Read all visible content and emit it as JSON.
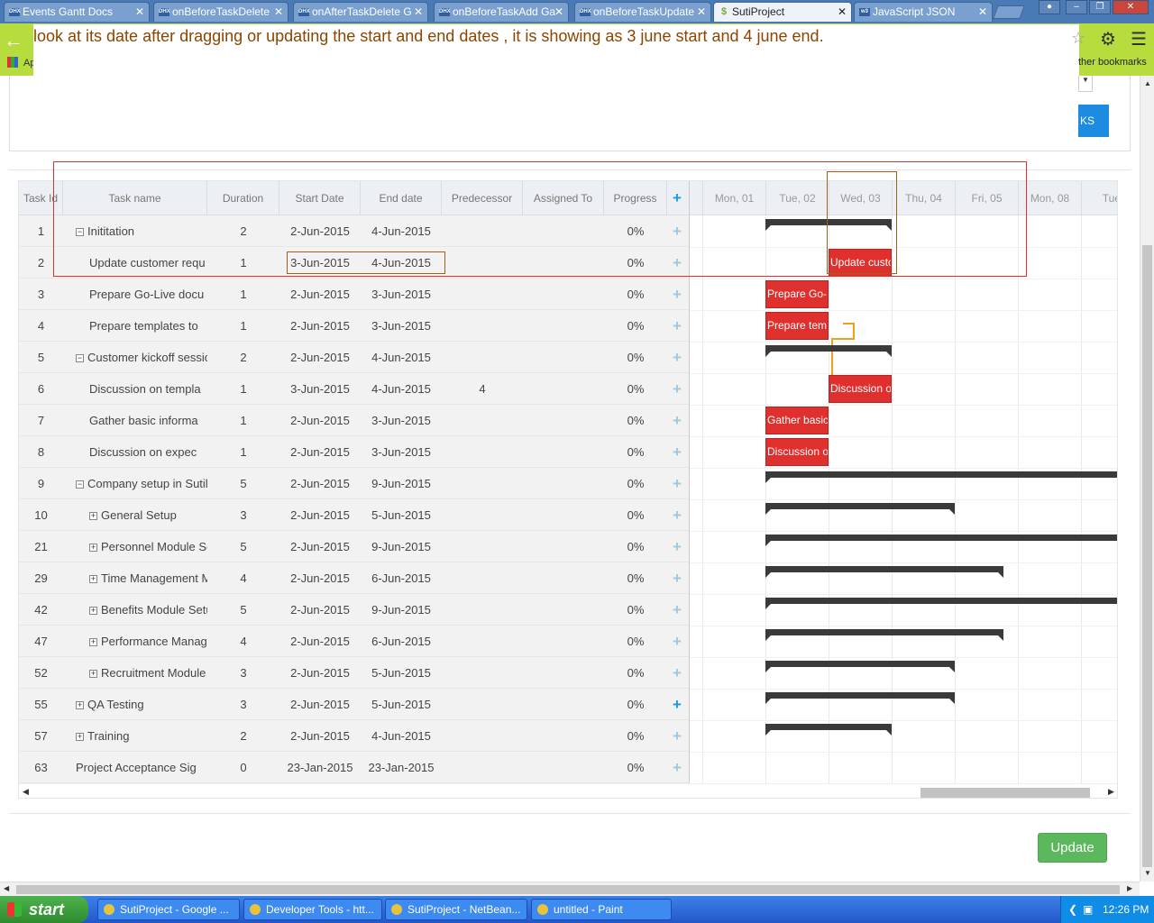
{
  "browser": {
    "tabs": [
      {
        "label": "Events Gantt Docs",
        "fav": "DHX"
      },
      {
        "label": "onBeforeTaskDelete",
        "fav": "DHX"
      },
      {
        "label": "onAfterTaskDelete G",
        "fav": "DHX"
      },
      {
        "label": "onBeforeTaskAdd Ga",
        "fav": "DHX"
      },
      {
        "label": "onBeforeTaskUpdate",
        "fav": "DHX"
      },
      {
        "label": "SutiProject",
        "fav": "$"
      },
      {
        "label": "JavaScript JSON",
        "fav": "w3"
      }
    ],
    "apps_label": "Ap",
    "other_bookmarks": "ther bookmarks"
  },
  "annotation": "look at its date after dragging or updating the start and end dates , it is showing as 3 june start and 4 june end.",
  "panel": {
    "button_label": "KS"
  },
  "grid": {
    "columns": [
      "Task Id",
      "Task name",
      "Duration",
      "Start Date",
      "End date",
      "Predecessor",
      "Assigned To",
      "Progress"
    ],
    "rows": [
      {
        "id": "1",
        "name": "Inititation",
        "dur": "2",
        "start": "2-Jun-2015",
        "end": "4-Jun-2015",
        "pred": "",
        "prog": "0%",
        "lvl": 0,
        "tog": "−"
      },
      {
        "id": "2",
        "name": "Update customer requ",
        "dur": "1",
        "start": "3-Jun-2015",
        "end": "4-Jun-2015",
        "pred": "",
        "prog": "0%",
        "lvl": 1,
        "tog": ""
      },
      {
        "id": "3",
        "name": "Prepare Go-Live docu",
        "dur": "1",
        "start": "2-Jun-2015",
        "end": "3-Jun-2015",
        "pred": "",
        "prog": "0%",
        "lvl": 1,
        "tog": ""
      },
      {
        "id": "4",
        "name": "Prepare templates to",
        "dur": "1",
        "start": "2-Jun-2015",
        "end": "3-Jun-2015",
        "pred": "",
        "prog": "0%",
        "lvl": 1,
        "tog": ""
      },
      {
        "id": "5",
        "name": "Customer kickoff sessio",
        "dur": "2",
        "start": "2-Jun-2015",
        "end": "4-Jun-2015",
        "pred": "",
        "prog": "0%",
        "lvl": 0,
        "tog": "−"
      },
      {
        "id": "6",
        "name": "Discussion on templa",
        "dur": "1",
        "start": "3-Jun-2015",
        "end": "4-Jun-2015",
        "pred": "4",
        "prog": "0%",
        "lvl": 1,
        "tog": ""
      },
      {
        "id": "7",
        "name": "Gather basic informa",
        "dur": "1",
        "start": "2-Jun-2015",
        "end": "3-Jun-2015",
        "pred": "",
        "prog": "0%",
        "lvl": 1,
        "tog": ""
      },
      {
        "id": "8",
        "name": "Discussion on expec",
        "dur": "1",
        "start": "2-Jun-2015",
        "end": "3-Jun-2015",
        "pred": "",
        "prog": "0%",
        "lvl": 1,
        "tog": ""
      },
      {
        "id": "9",
        "name": "Company setup in Sutil",
        "dur": "5",
        "start": "2-Jun-2015",
        "end": "9-Jun-2015",
        "pred": "",
        "prog": "0%",
        "lvl": 0,
        "tog": "−"
      },
      {
        "id": "10",
        "name": "General Setup",
        "dur": "3",
        "start": "2-Jun-2015",
        "end": "5-Jun-2015",
        "pred": "",
        "prog": "0%",
        "lvl": 1,
        "tog": "+"
      },
      {
        "id": "21",
        "name": "Personnel Module Se",
        "dur": "5",
        "start": "2-Jun-2015",
        "end": "9-Jun-2015",
        "pred": "",
        "prog": "0%",
        "lvl": 1,
        "tog": "+"
      },
      {
        "id": "29",
        "name": "Time Management M",
        "dur": "4",
        "start": "2-Jun-2015",
        "end": "6-Jun-2015",
        "pred": "",
        "prog": "0%",
        "lvl": 1,
        "tog": "+"
      },
      {
        "id": "42",
        "name": "Benefits Module Setu",
        "dur": "5",
        "start": "2-Jun-2015",
        "end": "9-Jun-2015",
        "pred": "",
        "prog": "0%",
        "lvl": 1,
        "tog": "+"
      },
      {
        "id": "47",
        "name": "Performance Manage",
        "dur": "4",
        "start": "2-Jun-2015",
        "end": "6-Jun-2015",
        "pred": "",
        "prog": "0%",
        "lvl": 1,
        "tog": "+"
      },
      {
        "id": "52",
        "name": "Recruitment Module",
        "dur": "3",
        "start": "2-Jun-2015",
        "end": "5-Jun-2015",
        "pred": "",
        "prog": "0%",
        "lvl": 1,
        "tog": "+"
      },
      {
        "id": "55",
        "name": "QA Testing",
        "dur": "3",
        "start": "2-Jun-2015",
        "end": "5-Jun-2015",
        "pred": "",
        "prog": "0%",
        "lvl": 0,
        "tog": "+"
      },
      {
        "id": "57",
        "name": "Training",
        "dur": "2",
        "start": "2-Jun-2015",
        "end": "4-Jun-2015",
        "pred": "",
        "prog": "0%",
        "lvl": 0,
        "tog": "+"
      },
      {
        "id": "63",
        "name": "Project Acceptance Sig",
        "dur": "0",
        "start": "23-Jan-2015",
        "end": "23-Jan-2015",
        "pred": "",
        "prog": "0%",
        "lvl": 0,
        "tog": ""
      }
    ]
  },
  "timeline": {
    "days": [
      "Mon, 01",
      "Tue, 02",
      "Wed, 03",
      "Thu, 04",
      "Fri, 05",
      "Mon, 08",
      "Tue,"
    ],
    "bars": [
      {
        "row": 0,
        "type": "project",
        "from": "2-Jun-2015",
        "to": "4-Jun-2015",
        "label": ""
      },
      {
        "row": 1,
        "type": "task",
        "from": "3-Jun-2015",
        "to": "4-Jun-2015",
        "label": "Update custo"
      },
      {
        "row": 2,
        "type": "task",
        "from": "2-Jun-2015",
        "to": "3-Jun-2015",
        "label": "Prepare Go-"
      },
      {
        "row": 3,
        "type": "task",
        "from": "2-Jun-2015",
        "to": "3-Jun-2015",
        "label": "Prepare tem"
      },
      {
        "row": 4,
        "type": "project",
        "from": "2-Jun-2015",
        "to": "4-Jun-2015",
        "label": ""
      },
      {
        "row": 5,
        "type": "task",
        "from": "3-Jun-2015",
        "to": "4-Jun-2015",
        "label": "Discussion o"
      },
      {
        "row": 6,
        "type": "task",
        "from": "2-Jun-2015",
        "to": "3-Jun-2015",
        "label": "Gather basic"
      },
      {
        "row": 7,
        "type": "task",
        "from": "2-Jun-2015",
        "to": "3-Jun-2015",
        "label": "Discussion o"
      },
      {
        "row": 8,
        "type": "project",
        "from": "2-Jun-2015",
        "to": "9-Jun-2015",
        "label": ""
      },
      {
        "row": 9,
        "type": "project",
        "from": "2-Jun-2015",
        "to": "5-Jun-2015",
        "label": ""
      },
      {
        "row": 10,
        "type": "project",
        "from": "2-Jun-2015",
        "to": "9-Jun-2015",
        "label": ""
      },
      {
        "row": 11,
        "type": "project",
        "from": "2-Jun-2015",
        "to": "6-Jun-2015",
        "label": ""
      },
      {
        "row": 12,
        "type": "project",
        "from": "2-Jun-2015",
        "to": "9-Jun-2015",
        "label": ""
      },
      {
        "row": 13,
        "type": "project",
        "from": "2-Jun-2015",
        "to": "6-Jun-2015",
        "label": ""
      },
      {
        "row": 14,
        "type": "project",
        "from": "2-Jun-2015",
        "to": "5-Jun-2015",
        "label": ""
      },
      {
        "row": 15,
        "type": "project",
        "from": "2-Jun-2015",
        "to": "5-Jun-2015",
        "label": ""
      },
      {
        "row": 16,
        "type": "project",
        "from": "2-Jun-2015",
        "to": "4-Jun-2015",
        "label": ""
      }
    ],
    "task_color": "#e0302d",
    "project_color": "#3a3a3a",
    "link_color": "#f0a020"
  },
  "update_button": "Update",
  "taskbar": {
    "start": "start",
    "items": [
      "SutiProject - Google ...",
      "Developer Tools - htt...",
      "SutiProject - NetBean...",
      "untitled - Paint"
    ],
    "clock": "12:26 PM"
  }
}
